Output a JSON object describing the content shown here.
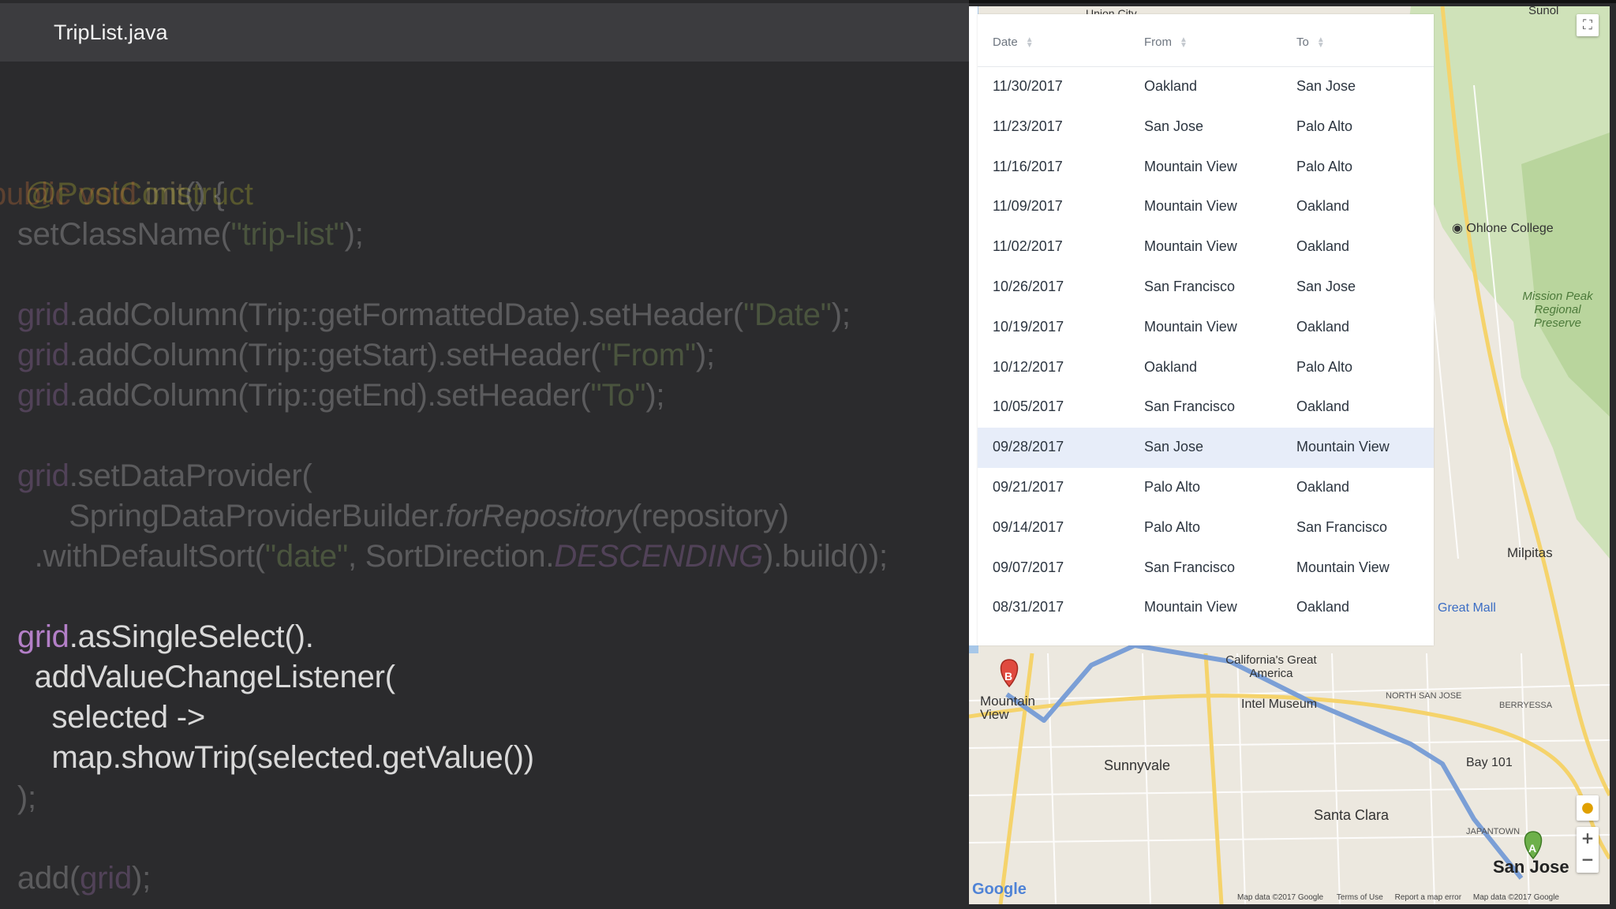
{
  "editor": {
    "tab_title": "TripList.java",
    "lines": {
      "l1": "@PostConstruct",
      "l2a": "public",
      "l2b": " void ",
      "l2c": "init",
      "l2d": "() {",
      "l3a": "  setClassName(",
      "l3b": "\"trip-list\"",
      "l3c": ");",
      "l4a": "  grid",
      "l4b": ".addColumn(Trip::getFormattedDate).setHeader(",
      "l4c": "\"Date\"",
      "l4d": ");",
      "l5a": "  grid",
      "l5b": ".addColumn(Trip::getStart).setHeader(",
      "l5c": "\"From\"",
      "l5d": ");",
      "l6a": "  grid",
      "l6b": ".addColumn(Trip::getEnd).setHeader(",
      "l6c": "\"To\"",
      "l6d": ");",
      "l7a": "  grid",
      "l7b": ".setDataProvider(",
      "l8a": "        SpringDataProviderBuilder.",
      "l8b": "forRepository",
      "l8c": "(repository)",
      "l9a": "    .withDefaultSort(",
      "l9b": "\"date\"",
      "l9c": ", SortDirection.",
      "l9d": "DESCENDING",
      "l9e": ").build());",
      "l10a": "  grid",
      "l10b": ".asSingleSelect().",
      "l11": "    addValueChangeListener(",
      "l12": "      selected ->",
      "l13": "      map.showTrip(selected.getValue())",
      "l14": "  );",
      "l15a": "  add(",
      "l15b": "grid",
      "l15c": ");"
    }
  },
  "grid": {
    "headers": {
      "date": "Date",
      "from": "From",
      "to": "To"
    },
    "selected_index": 9,
    "rows": [
      {
        "date": "11/30/2017",
        "from": "Oakland",
        "to": "San Jose"
      },
      {
        "date": "11/23/2017",
        "from": "San Jose",
        "to": "Palo Alto"
      },
      {
        "date": "11/16/2017",
        "from": "Mountain View",
        "to": "Palo Alto"
      },
      {
        "date": "11/09/2017",
        "from": "Mountain View",
        "to": "Oakland"
      },
      {
        "date": "11/02/2017",
        "from": "Mountain View",
        "to": "Oakland"
      },
      {
        "date": "10/26/2017",
        "from": "San Francisco",
        "to": "San Jose"
      },
      {
        "date": "10/19/2017",
        "from": "Mountain View",
        "to": "Oakland"
      },
      {
        "date": "10/12/2017",
        "from": "Oakland",
        "to": "Palo Alto"
      },
      {
        "date": "10/05/2017",
        "from": "San Francisco",
        "to": "Oakland"
      },
      {
        "date": "09/28/2017",
        "from": "San Jose",
        "to": "Mountain View"
      },
      {
        "date": "09/21/2017",
        "from": "Palo Alto",
        "to": "Oakland"
      },
      {
        "date": "09/14/2017",
        "from": "Palo Alto",
        "to": "San Francisco"
      },
      {
        "date": "09/07/2017",
        "from": "San Francisco",
        "to": "Mountain View"
      },
      {
        "date": "08/31/2017",
        "from": "Mountain View",
        "to": "Oakland"
      }
    ]
  },
  "map": {
    "labels": {
      "union_city": "Union City",
      "sunol": "Sunol",
      "ohlone": "Ohlone College",
      "mission_peak": "Mission Peak Regional Preserve",
      "milpitas": "Milpitas",
      "great_mall": "Great Mall",
      "californias": "California's Great America",
      "intel": "Intel Museum",
      "mountain_view": "Mountain View",
      "sunnyvale": "Sunnyvale",
      "bay101": "Bay 101",
      "santa_clara": "Santa Clara",
      "san_jose": "San Jose",
      "north_san_jose": "NORTH SAN JOSE",
      "berryessa": "BERRYESSA",
      "japantown": "JAPANTOWN",
      "google": "Google",
      "map_data_bar": "Map data ©2017 Google",
      "terms": "Terms of Use",
      "report": "Report a map error",
      "map_data_right": "Map data ©2017 Google",
      "marker_a": "A",
      "marker_b": "B"
    },
    "route_color": "#7b9fd6",
    "zoom_in": "+",
    "zoom_out": "−"
  }
}
